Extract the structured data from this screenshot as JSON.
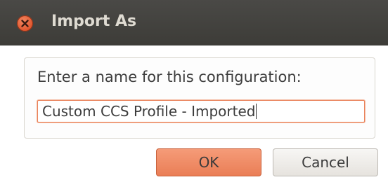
{
  "window": {
    "title": "Import As"
  },
  "form": {
    "prompt": "Enter a name for this configuration:",
    "name_value": "Custom CCS Profile - Imported"
  },
  "buttons": {
    "ok_label": "OK",
    "cancel_label": "Cancel"
  },
  "colors": {
    "titlebar": "#3d3c38",
    "close": "#e0552d",
    "ok": "#ea7e56",
    "focus_border": "#e9825a"
  },
  "icons": {
    "close": "close-icon"
  }
}
